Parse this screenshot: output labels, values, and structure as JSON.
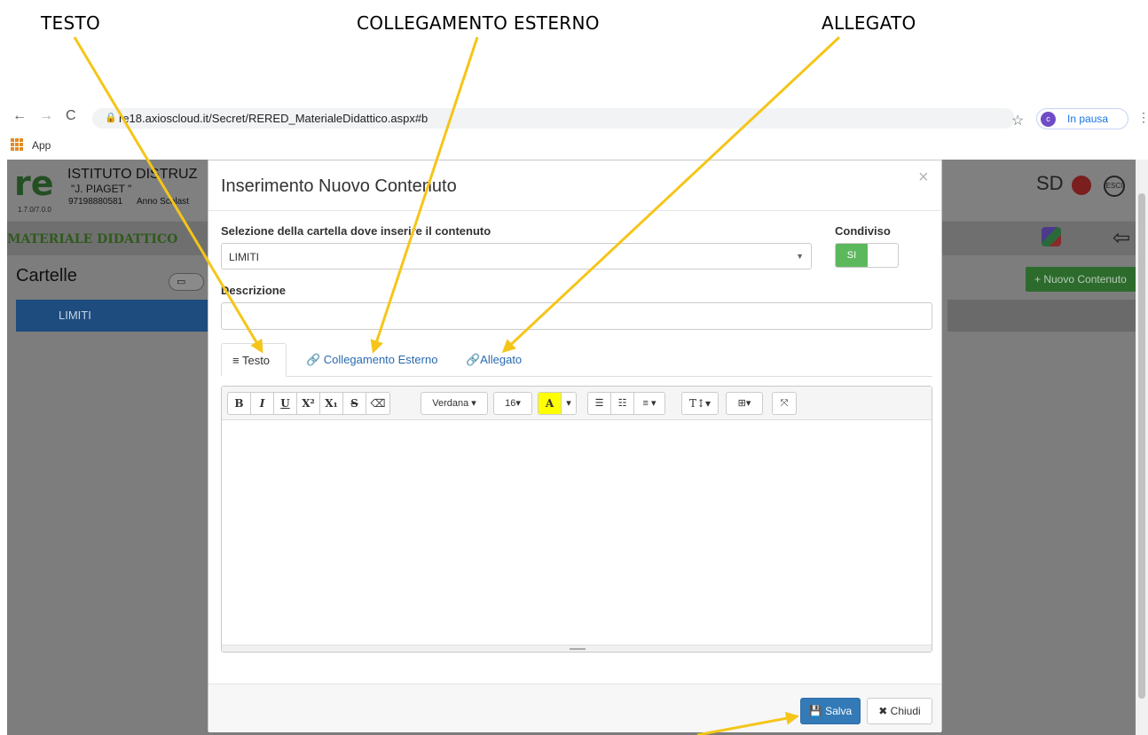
{
  "annotations": {
    "testo": "TESTO",
    "collegamento": "COLLEGAMENTO ESTERNO",
    "allegato": "ALLEGATO",
    "arrow_color": "#f5c518"
  },
  "browser": {
    "back": "←",
    "forward": "→",
    "reload": "C",
    "url": "re18.axioscloud.it/Secret/RERED_MaterialeDidattico.aspx#b",
    "profile_initial": "c",
    "profile_status": "In pausa",
    "bookmark_apps": "App"
  },
  "app": {
    "logo": "re",
    "school_name": "ISTITUTO DISTRUZ",
    "school_sub": "\"J. PIAGET \"",
    "school_code": "97198880581",
    "version": "1.7.0/7.0.0",
    "anno": "Anno Scolast",
    "header_icons": "SD",
    "section_title": "MATERIALE DIDATTICO",
    "back_arrow": "⇦",
    "cartelle": "Cartelle",
    "folder_item": "LIMITI",
    "nuovo_contenuto": "+ Nuovo Contenuto"
  },
  "modal": {
    "title": "Inserimento Nuovo Contenuto",
    "close": "×",
    "folder_label": "Selezione della cartella dove inserire il contenuto",
    "folder_value": "LIMITI",
    "shared_label": "Condiviso",
    "shared_value": "SI",
    "description_label": "Descrizione",
    "description_value": "",
    "tabs": {
      "testo": "≡ Testo",
      "collegamento": "🔗 Collegamento Esterno",
      "allegato": "🔗Allegato"
    },
    "toolbar": {
      "bold": "B",
      "italic": "I",
      "underline": "U",
      "superscript": "X²",
      "subscript": "X₁",
      "strike": "S",
      "eraser": "⌫",
      "font": "Verdana ▾",
      "size": "16▾",
      "color": "A",
      "color_caret": "▾",
      "ul": "☰",
      "ol": "☷",
      "align": "≡ ▾",
      "line_height": "T↕▾",
      "table": "⊞▾",
      "fullscreen": "⤧"
    },
    "save": "💾 Salva",
    "close_button": "✖ Chiudi"
  }
}
